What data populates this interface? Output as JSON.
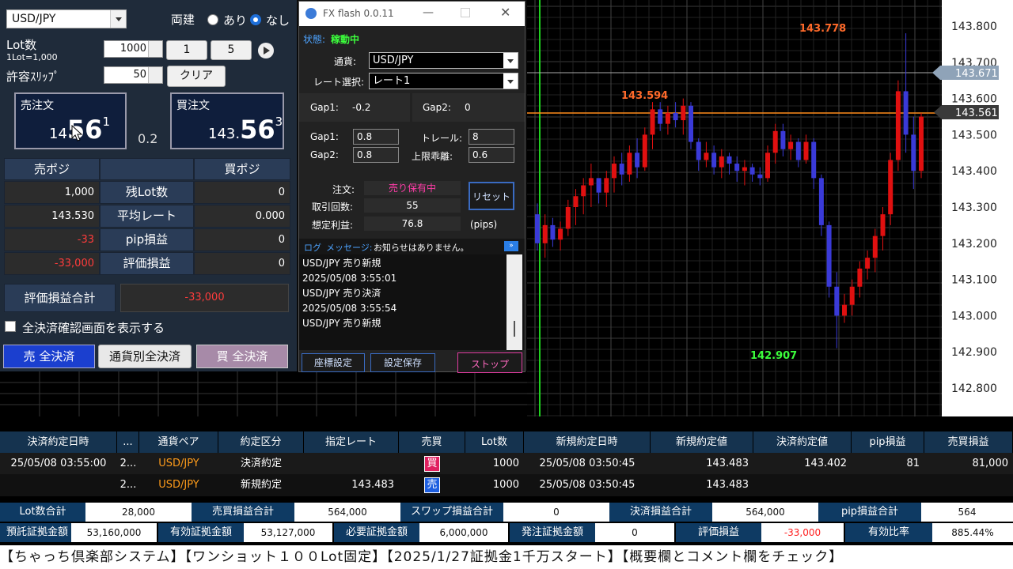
{
  "trade": {
    "symbol": "USD/JPY",
    "hedge_label": "両建",
    "hedge_on": "あり",
    "hedge_off": "なし",
    "lot_label": "Lot数",
    "lot_sub": "1Lot=1,000",
    "lot_value": "1000",
    "lot_btn1": "1",
    "lot_btn5": "5",
    "slip_label": "許容ｽﾘｯﾌﾟ",
    "slip_value": "50",
    "clear_label": "クリア",
    "sell_label": "売注文",
    "sell_price_small": "14",
    "sell_price_big": "56",
    "sell_price_sup": "1",
    "spread": "0.2",
    "buy_label": "買注文",
    "buy_price_small": "143.",
    "buy_price_big": "56",
    "buy_price_sup": "3",
    "pos_sell_hdr": "売ポジ",
    "pos_buy_hdr": "買ポジ",
    "rows": [
      {
        "label": "残Lot数",
        "sell": "1,000",
        "buy": "0"
      },
      {
        "label": "平均レート",
        "sell": "143.530",
        "buy": "0.000"
      },
      {
        "label": "pip損益",
        "sell": "-33",
        "buy": "0"
      },
      {
        "label": "評価損益",
        "sell": "-33,000",
        "buy": "0"
      }
    ],
    "total_label": "評価損益合計",
    "total_value": "-33,000",
    "confirm_label": "全決済確認画面を表示する",
    "sell_all": "売 全決済",
    "pair_all": "通貨別全決済",
    "buy_all": "買 全決済"
  },
  "fx": {
    "title": "FX flash 0.0.11",
    "status_label": "状態:",
    "status_value": "稼動中",
    "currency_label": "通貨:",
    "currency_value": "USD/JPY",
    "rate_label": "レート選択:",
    "rate_value": "レート1",
    "gap1_label": "Gap1:",
    "gap1_value": "-0.2",
    "gap2_label": "Gap2:",
    "gap2_value": "0",
    "gap1_in_label": "Gap1:",
    "gap1_in": "0.8",
    "trail_label": "トレール:",
    "trail_in": "8",
    "gap2_in_label": "Gap2:",
    "gap2_in": "0.8",
    "limit_label": "上限乖離:",
    "limit_in": "0.6",
    "order_label": "注文:",
    "order_value": "売り保有中",
    "count_label": "取引回数:",
    "count_value": "55",
    "profit_label": "想定利益:",
    "profit_value": "76.8",
    "profit_unit": "(pips)",
    "reset": "リセット",
    "log_label": "ログ",
    "msg_label": "メッセージ:",
    "msg_value": "お知らせはありません。",
    "log": [
      "USD/JPY 売り新規",
      "2025/05/08 3:55:01",
      "USD/JPY 売り決済",
      "2025/05/08 3:55:54",
      "USD/JPY 売り新規"
    ],
    "btn_coord": "座標設定",
    "btn_save": "設定保存",
    "btn_stop": "ストップ"
  },
  "chart_data": {
    "type": "candlestick",
    "y_ticks": [
      "143.800",
      "143.700",
      "143.600",
      "143.500",
      "143.400",
      "143.300",
      "143.200",
      "143.100",
      "143.000",
      "142.900",
      "142.800"
    ],
    "price_tags": [
      "143.671",
      "143.561"
    ],
    "annotations": [
      "143.594",
      "143.778",
      "142.907"
    ],
    "colors": {
      "up": "#e01010",
      "down": "#3a3ad8",
      "level": "#ff8c1a"
    }
  },
  "orders": {
    "headers": [
      "決済約定日時",
      "...",
      "通貨ペア",
      "約定区分",
      "指定レート",
      "売買",
      "Lot数",
      "新規約定日時",
      "新規約定値",
      "決済約定値",
      "pip損益",
      "売買損益"
    ],
    "rows": [
      [
        "25/05/08 03:55:00",
        "2...",
        "USD/JPY",
        "決済約定",
        "",
        "買",
        "1000",
        "25/05/08 03:50:45",
        "143.483",
        "143.402",
        "81",
        "81,000"
      ],
      [
        "",
        "2...",
        "USD/JPY",
        "新規約定",
        "143.483",
        "売",
        "1000",
        "25/05/08 03:50:45",
        "143.483",
        "",
        "",
        ""
      ]
    ]
  },
  "summary": {
    "row1": [
      {
        "label": "Lot数合計",
        "value": "28,000"
      },
      {
        "label": "売買損益合計",
        "value": "564,000"
      },
      {
        "label": "スワップ損益合計",
        "value": "0"
      },
      {
        "label": "決済損益合計",
        "value": "564,000"
      },
      {
        "label": "pip損益合計",
        "value": "564"
      }
    ],
    "row2": [
      {
        "label": "預託証拠金額",
        "value": "53,160,000"
      },
      {
        "label": "有効証拠金額",
        "value": "53,127,000"
      },
      {
        "label": "必要証拠金額",
        "value": "6,000,000"
      },
      {
        "label": "発注証拠金額",
        "value": "0"
      },
      {
        "label": "評価損益",
        "value": "-33,000"
      },
      {
        "label": "有効比率",
        "value": "885.44%"
      }
    ]
  },
  "ticker": "【ちゃっち倶楽部システム】【ワンショット１００Lot固定】【2025/1/27証拠金1千万スタート】【概要欄とコメント欄をチェック】"
}
